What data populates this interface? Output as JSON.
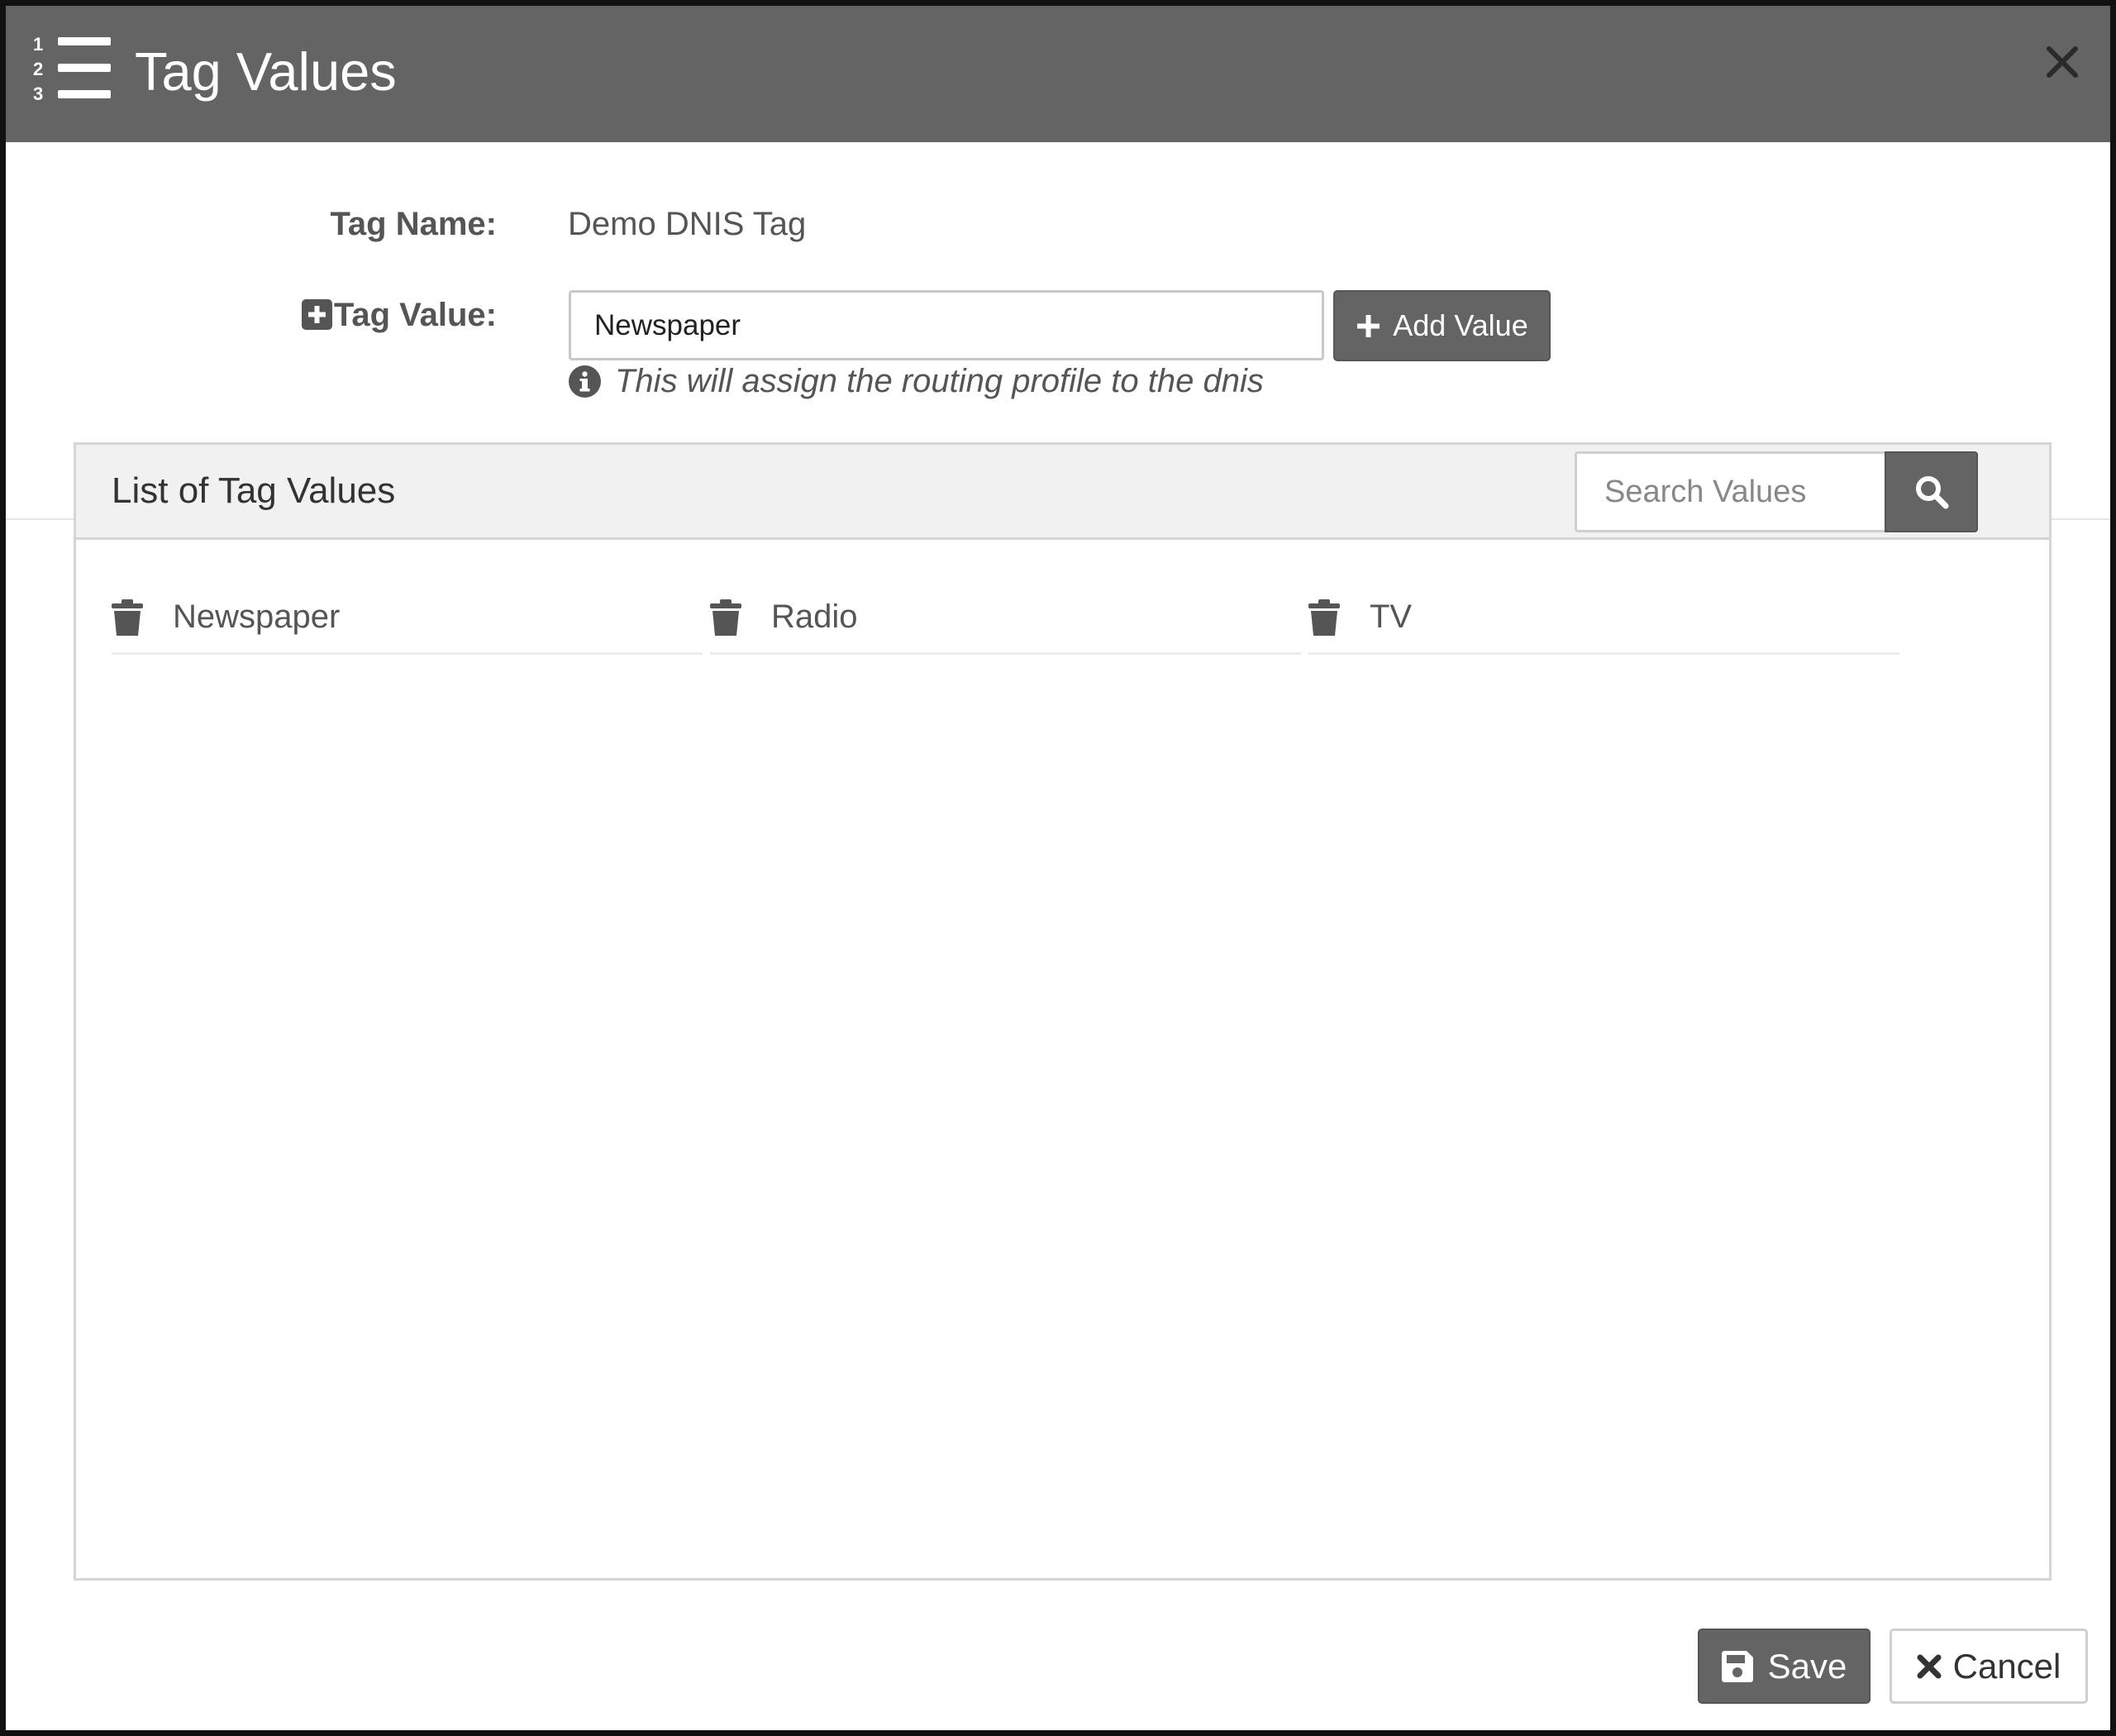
{
  "dialog": {
    "title": "Tag Values",
    "header_icon": "ordered-list-icon",
    "close_icon": "close-icon"
  },
  "form": {
    "tag_name_label": "Tag Name:",
    "tag_name_value": "Demo DNIS Tag",
    "tag_value_label": "Tag Value:",
    "tag_value_input": "Newspaper",
    "add_button_label": "Add Value",
    "help_text": "This will assign the routing profile to the dnis"
  },
  "list_panel": {
    "title": "List of Tag Values",
    "search_placeholder": "Search Values",
    "items": [
      {
        "label": "Newspaper"
      },
      {
        "label": "Radio"
      },
      {
        "label": "TV"
      }
    ]
  },
  "footer": {
    "save_label": "Save",
    "cancel_label": "Cancel"
  },
  "colors": {
    "header_bg": "#646464",
    "button_dark": "#646464",
    "panel_head_bg": "#f1f1f1",
    "text_muted": "#555555"
  }
}
